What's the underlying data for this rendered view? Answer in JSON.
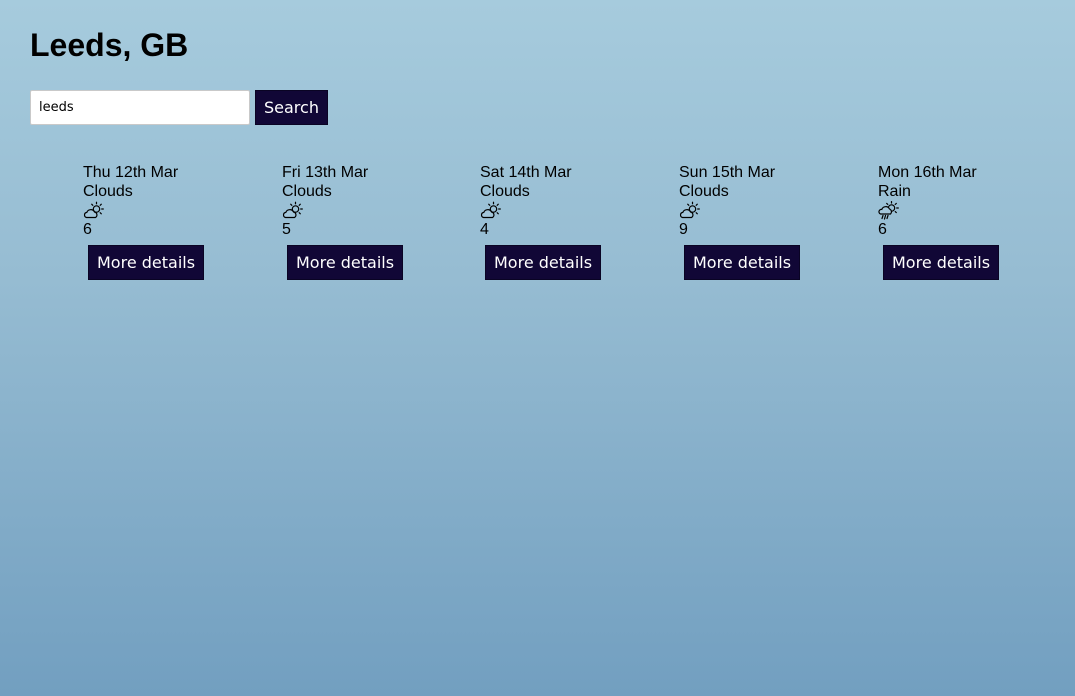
{
  "header": {
    "title": "Leeds, GB"
  },
  "search": {
    "value": "leeds",
    "button_label": "Search"
  },
  "forecast": [
    {
      "date": "Thu 12th Mar",
      "description": "Clouds",
      "icon": "partly-cloudy-icon",
      "temperature": "6",
      "button_label": "More details"
    },
    {
      "date": "Fri 13th Mar",
      "description": "Clouds",
      "icon": "partly-cloudy-icon",
      "temperature": "5",
      "button_label": "More details"
    },
    {
      "date": "Sat 14th Mar",
      "description": "Clouds",
      "icon": "partly-cloudy-icon",
      "temperature": "4",
      "button_label": "More details"
    },
    {
      "date": "Sun 15th Mar",
      "description": "Clouds",
      "icon": "partly-cloudy-icon",
      "temperature": "9",
      "button_label": "More details"
    },
    {
      "date": "Mon 16th Mar",
      "description": "Rain",
      "icon": "rain-sun-icon",
      "temperature": "6",
      "button_label": "More details"
    }
  ],
  "colors": {
    "button_bg": "#110736",
    "button_text": "#ffffff",
    "bg_top": "#a6cbdd",
    "bg_bottom": "#729fc0"
  }
}
